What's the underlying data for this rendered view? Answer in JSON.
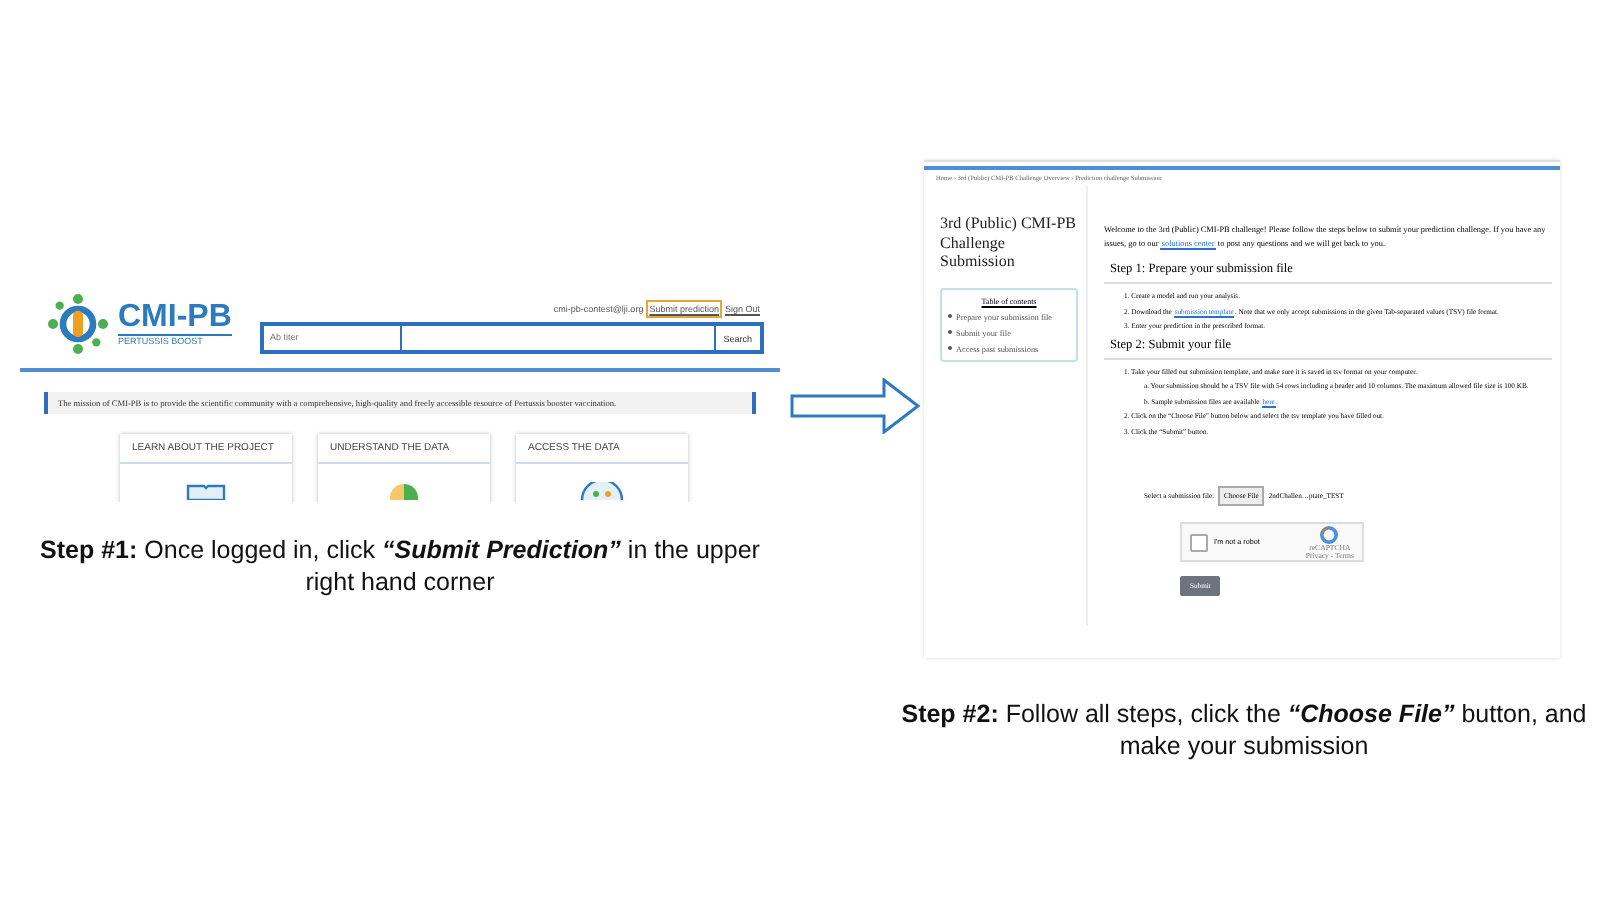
{
  "left_screen": {
    "contact": "cmi-pb-contest@lji.org",
    "submit_link": "Submit prediction",
    "signout_link": "Sign Out",
    "logo_text": "CMI-PB",
    "logo_tagline": "PERTUSSIS BOOST",
    "dropdown": "Ab titer",
    "search_button": "Search",
    "mission": "The mission of CMI-PB is to provide the scientific community with a comprehensive, high-quality and freely accessible resource of Pertussis booster vaccination.",
    "cards": [
      {
        "title": "LEARN ABOUT THE PROJECT",
        "kind": "book"
      },
      {
        "title": "UNDERSTAND THE DATA",
        "kind": "pie"
      },
      {
        "title": "ACCESS THE DATA",
        "kind": "people"
      }
    ]
  },
  "caption_1": [
    {
      "text": "Step #1:",
      "bold": true,
      "italic": false
    },
    {
      "text": " Once logged in, click ",
      "bold": false,
      "italic": false
    },
    {
      "text": "“Submit Prediction”",
      "bold": true,
      "italic": true
    },
    {
      "text": " in the upper right hand corner",
      "bold": false,
      "italic": false
    }
  ],
  "right_screen": {
    "breadcrumb": "Home › 3rd (Public) CMI-PB Challenge Overview › Prediction challenge Submission",
    "title": "3rd (Public) CMI-PB Challenge Submission",
    "toc": {
      "title": "Table of contents",
      "items": [
        "Prepare your submission file",
        "Submit your file",
        "Access past submissions"
      ]
    },
    "intro": [
      {
        "text": "Welcome to the 3rd (Public) CMI-PB challenge! Please follow the steps below to submit your prediction challenge. If you have any issues, go to our ",
        "link": false
      },
      {
        "text": "solutions center",
        "link": true
      },
      {
        "text": " to post any questions and we will get back to you.",
        "link": false
      }
    ],
    "step_1": {
      "heading": "Step 1: Prepare your submission file",
      "items": [
        [
          {
            "text": "1. Create a model and run your analysis.",
            "link": false
          }
        ],
        [
          {
            "text": "2. Download the ",
            "link": false
          },
          {
            "text": "submission template",
            "link": true
          },
          {
            "text": ". Note that we only accept submissions in the given Tab-separated values (TSV) file format.",
            "link": false
          }
        ],
        [
          {
            "text": "3. Enter your prediction in the prescribed format.",
            "link": false
          }
        ]
      ]
    },
    "step_2": {
      "heading": "Step 2: Submit your file",
      "items": [
        {
          "indent": false,
          "parts": [
            {
              "text": "1. Take your filled out submission template, and make sure it is saved in tsv format on your computer.",
              "link": false
            }
          ]
        },
        {
          "indent": true,
          "parts": [
            {
              "text": "a. Your submission should be a TSV file with 54 rows including a header and 10 columns. The maximum allowed file size is 100 KB.",
              "link": false
            }
          ]
        },
        {
          "indent": true,
          "parts": [
            {
              "text": "b. Sample submission files are available ",
              "link": false
            },
            {
              "text": "here",
              "link": true
            },
            {
              "text": ".",
              "link": false
            }
          ]
        },
        {
          "indent": false,
          "parts": [
            {
              "text": "2. Click on the “Choose File” button below and select the tsv template you have filled out.",
              "link": false
            }
          ]
        },
        {
          "indent": false,
          "parts": [
            {
              "text": "3. Click the “Submit” button.",
              "link": false
            }
          ]
        }
      ]
    },
    "file_label": "Select a submission file:",
    "choose_button": "Choose File",
    "file_name": "2ndChallen…ptate_TEST",
    "captcha": {
      "label": "I'm not a robot",
      "checked": false,
      "brand": "reCAPTCHA",
      "links": "Privacy - Terms"
    },
    "submit_button": "Submit"
  },
  "caption_2": [
    {
      "text": "Step #2:",
      "bold": true,
      "italic": false
    },
    {
      "text": " Follow all steps, click the ",
      "bold": false,
      "italic": false
    },
    {
      "text": "“Choose File”",
      "bold": true,
      "italic": true
    },
    {
      "text": " button, and make your submission",
      "bold": false,
      "italic": false
    }
  ]
}
